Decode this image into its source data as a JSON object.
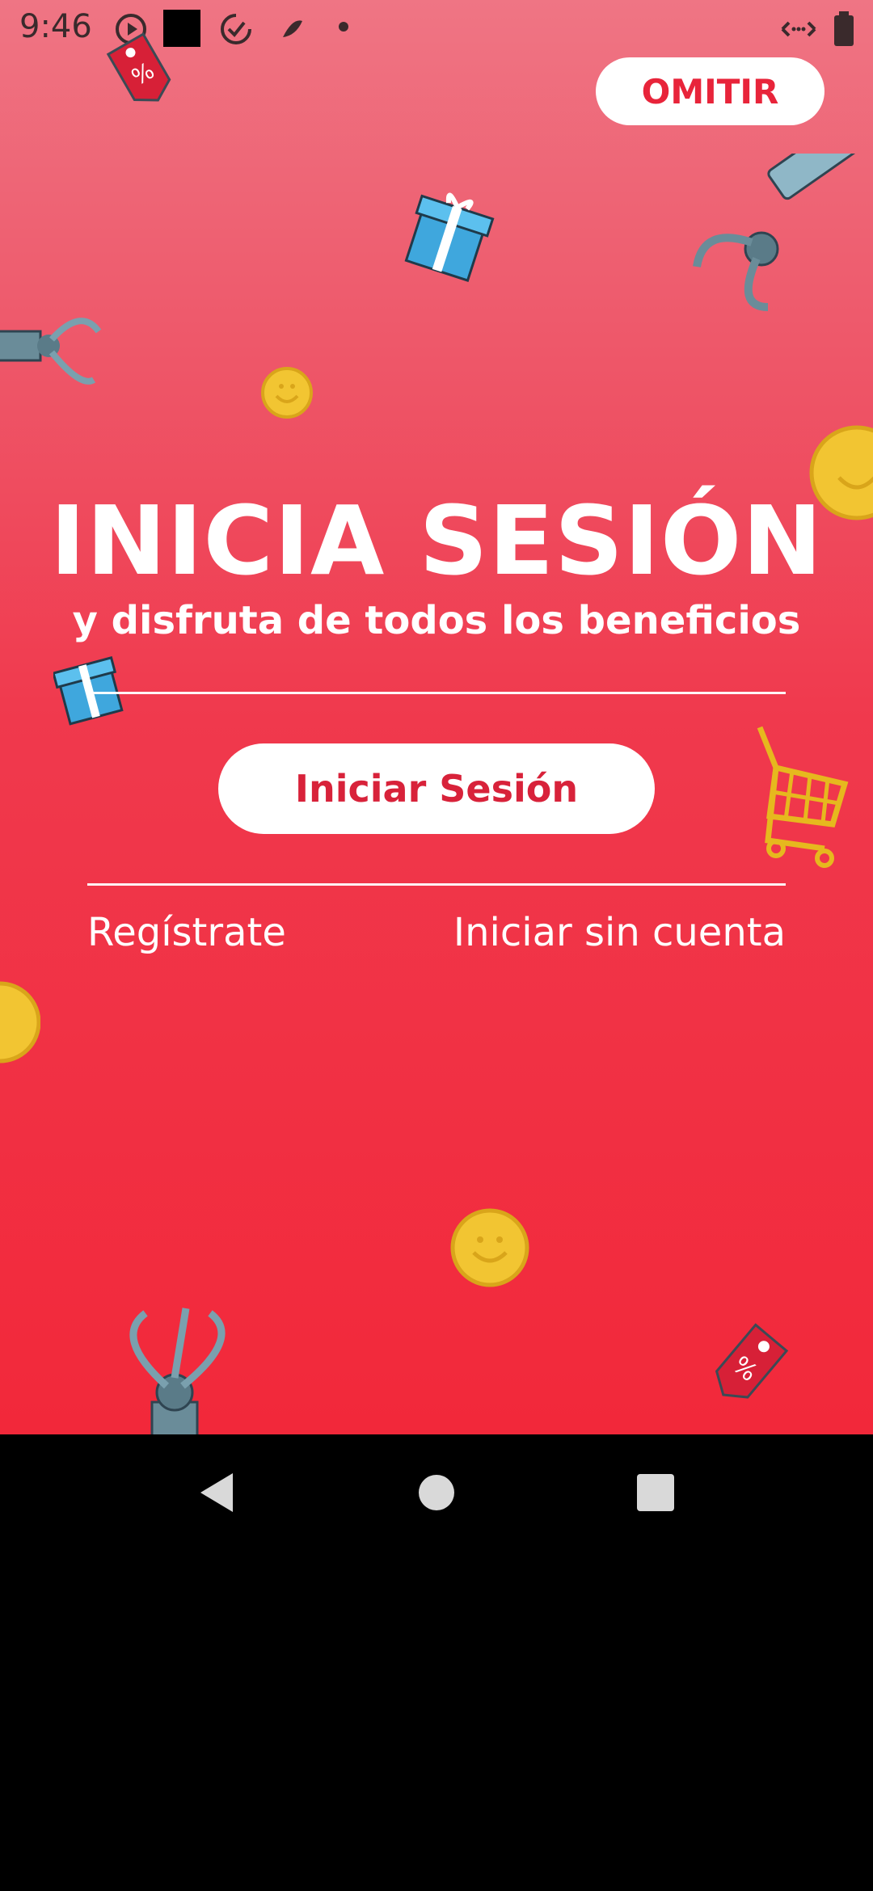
{
  "status_bar": {
    "time": "9:46"
  },
  "skip_button": {
    "label": "OMITIR"
  },
  "hero": {
    "title": "INICIA SESIÓN",
    "subtitle": "y disfruta de todos los beneficios"
  },
  "login_button": {
    "label": "Iniciar Sesión"
  },
  "links": {
    "register": "Regístrate",
    "guest": "Iniciar sin cuenta"
  },
  "colors": {
    "accent": "#e8243a",
    "background_top": "#ef7584",
    "background_bottom": "#f2283a",
    "coin": "#f2c532"
  },
  "icons": {
    "nav_back": "back-triangle-icon",
    "nav_home": "home-circle-icon",
    "nav_recents": "recents-square-icon"
  }
}
